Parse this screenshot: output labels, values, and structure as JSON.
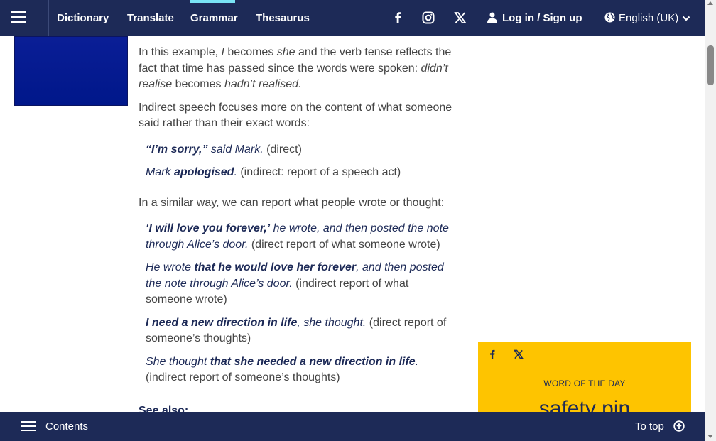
{
  "nav": {
    "links": [
      "Dictionary",
      "Translate",
      "Grammar",
      "Thesaurus"
    ],
    "active": "Grammar",
    "social_icons": [
      "facebook-icon",
      "instagram-icon",
      "x-icon"
    ],
    "login_label": "Log in / Sign up",
    "language_label": "English (UK)",
    "accent_color": "#79e3f4",
    "bg_color": "#1d2a57"
  },
  "article": {
    "para1": {
      "t1": "In this example, ",
      "t2": "I",
      "t3": " becomes ",
      "t4": "she",
      "t5": " and the verb tense reflects the fact that time has passed since the words were spoken: ",
      "t6": "didn’t realise",
      "t7": " becomes ",
      "t8": "hadn’t realised",
      "t9": "."
    },
    "para2": "Indirect speech focuses more on the content of what someone said rather than their exact words:",
    "ex1": {
      "b": "“I’m sorry,”",
      "i": " said Mark.",
      "n": " (direct)"
    },
    "ex2": {
      "i1": "Mark ",
      "b": "apologised",
      "i2": ".",
      "n": " (indirect: report of a speech act)"
    },
    "para3": "In a similar way, we can report what people wrote or thought:",
    "ex3": {
      "b": "‘I will love you forever,’",
      "i": " he wrote, and then posted the note through Alice’s door.",
      "n": " (direct report of what someone wrote)"
    },
    "ex4": {
      "i1": "He wrote ",
      "b": "that he would love her forever",
      "i2": ", and then posted the note through Alice’s door.",
      "n": " (indirect report of what someone wrote)"
    },
    "ex5": {
      "b": "I need a new direction in life",
      "i": ", she thought.",
      "n": " (direct report of someone’s thoughts)"
    },
    "ex6": {
      "i1": "She thought ",
      "b": "that she needed a new direction in life",
      "i2": ".",
      "n": " (indirect report of someone’s thoughts)"
    },
    "see_also": "See also:"
  },
  "wotd": {
    "label": "WORD OF THE DAY",
    "word": "safety pin",
    "bg_color": "#fec400"
  },
  "bottom": {
    "contents_label": "Contents",
    "to_top_label": "To top"
  }
}
